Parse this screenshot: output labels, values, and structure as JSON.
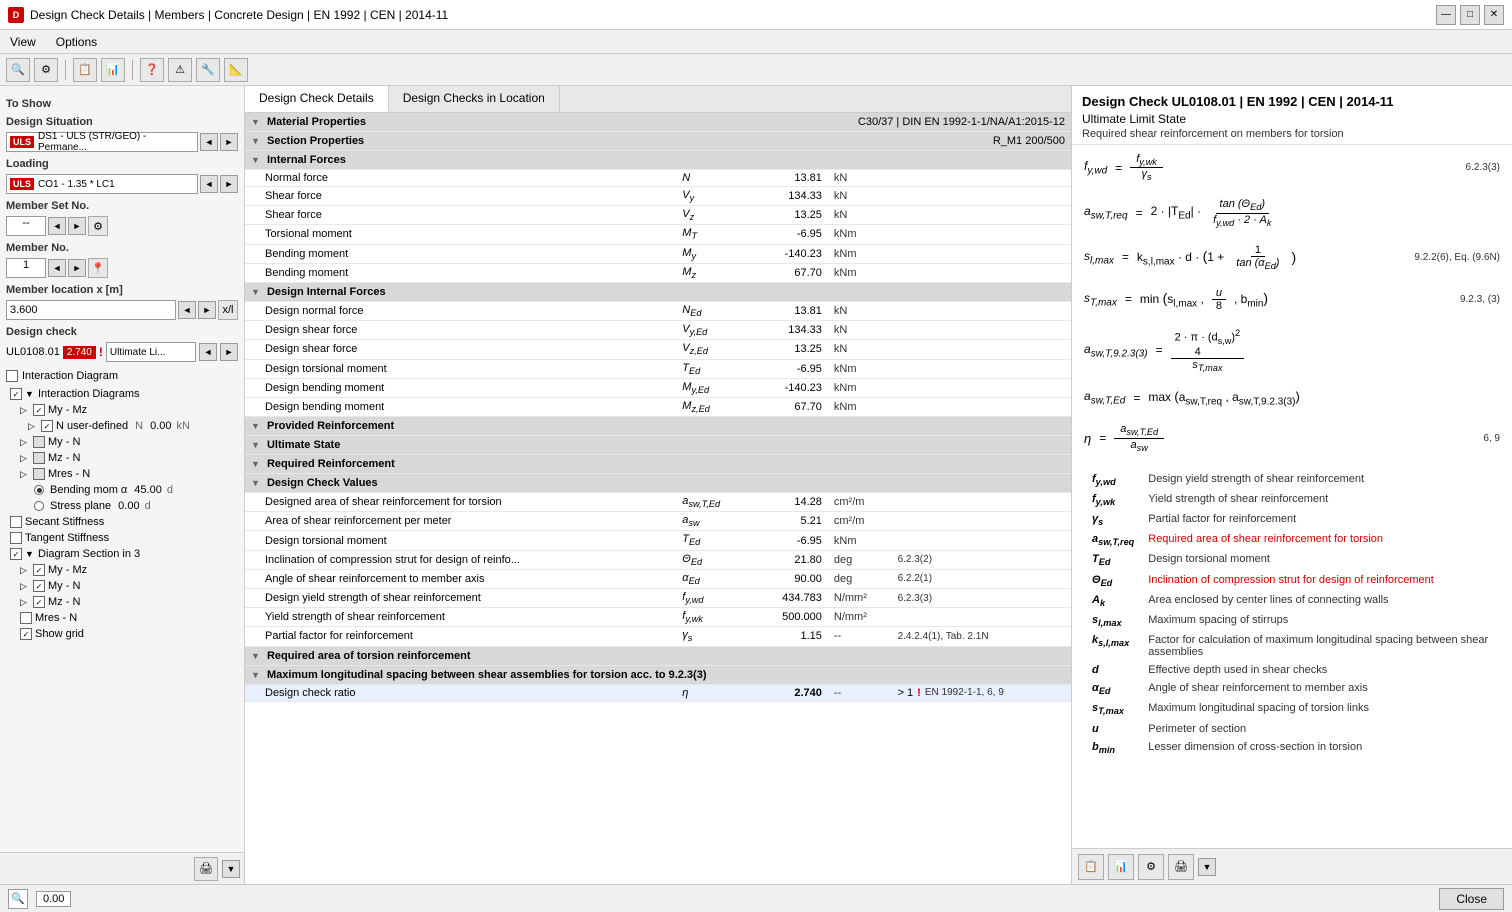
{
  "titleBar": {
    "title": "Design Check Details | Members | Concrete Design | EN 1992 | CEN | 2014-11",
    "minLabel": "—",
    "maxLabel": "□",
    "closeLabel": "✕"
  },
  "menuBar": {
    "items": [
      "View",
      "Options"
    ]
  },
  "leftPanel": {
    "toShow": "To Show",
    "designSituation": "Design Situation",
    "ds1Label": "DS1 - ULS (STR/GEO) - Permane...",
    "loading": "Loading",
    "co1Label": "CO1 - 1.35 * LC1",
    "memberSetNo": "Member Set No.",
    "memberSetVal": "--",
    "memberNo": "Member No.",
    "memberNoVal": "1",
    "memberLocation": "Member location x [m]",
    "memberLocationVal": "3.600",
    "designCheck": "Design check",
    "designCheckVal": "UL0108.01",
    "designCheckRatio": "2.740",
    "designCheckType": "Ultimate Li...",
    "interactionDiagram": "Interaction Diagram",
    "tree": {
      "interactionDiagrams": "Interaction Diagrams",
      "myMz": "My - Mz",
      "nUserDefined": "N user-defined",
      "nVal": "N",
      "nNum": "0.00",
      "myN": "My - N",
      "mzN": "Mz - N",
      "mresN": "Mres - N",
      "bendingMoment": "Bending mom α",
      "bendingVal": "45.00",
      "bendingUnit": "d",
      "secantStiffness": "Secant Stiffness",
      "tangentStiffness": "Tangent Stiffness",
      "diagramSection": "Diagram Section in 3",
      "myMz2": "My - Mz",
      "myN2": "My - N",
      "mzN2": "Mz - N",
      "mresN2": "Mres - N",
      "showGrid": "Show grid",
      "stressPlane": "Stress plane",
      "stressVal": "0.00",
      "stressUnit": "d"
    }
  },
  "tabs": {
    "tab1": "Design Check Details",
    "tab2": "Design Checks in Location"
  },
  "centerPanel": {
    "materialProps": "Material Properties",
    "materialVal": "C30/37 | DIN EN 1992-1-1/NA/A1:2015-12",
    "sectionProps": "Section Properties",
    "sectionVal": "R_M1 200/500",
    "internalForces": "Internal Forces",
    "forces": [
      {
        "name": "Normal force",
        "symbol": "N",
        "value": "13.81",
        "unit": "kN"
      },
      {
        "name": "Shear force",
        "symbol": "Vy",
        "value": "134.33",
        "unit": "kN"
      },
      {
        "name": "Shear force",
        "symbol": "Vz",
        "value": "13.25",
        "unit": "kN"
      },
      {
        "name": "Torsional moment",
        "symbol": "MT",
        "value": "-6.95",
        "unit": "kNm"
      },
      {
        "name": "Bending moment",
        "symbol": "My",
        "value": "-140.23",
        "unit": "kNm"
      },
      {
        "name": "Bending moment",
        "symbol": "Mz",
        "value": "67.70",
        "unit": "kNm"
      }
    ],
    "designInternalForces": "Design Internal Forces",
    "designForces": [
      {
        "name": "Design normal force",
        "symbol": "NEd",
        "value": "13.81",
        "unit": "kN"
      },
      {
        "name": "Design shear force",
        "symbol": "Vy,Ed",
        "value": "134.33",
        "unit": "kN"
      },
      {
        "name": "Design shear force",
        "symbol": "Vz,Ed",
        "value": "13.25",
        "unit": "kN"
      },
      {
        "name": "Design torsional moment",
        "symbol": "TEd",
        "value": "-6.95",
        "unit": "kNm"
      },
      {
        "name": "Design bending moment",
        "symbol": "My,Ed",
        "value": "-140.23",
        "unit": "kNm"
      },
      {
        "name": "Design bending moment",
        "symbol": "Mz,Ed",
        "value": "67.70",
        "unit": "kNm"
      }
    ],
    "providedReinforcement": "Provided Reinforcement",
    "ultimateState": "Ultimate State",
    "requiredReinforcement": "Required Reinforcement",
    "designCheckValues": "Design Check Values",
    "checkValues": [
      {
        "name": "Designed area of shear reinforcement for torsion",
        "symbol": "asw,T,Ed",
        "value": "14.28",
        "unit": "cm²/m",
        "ref": ""
      },
      {
        "name": "Area of shear reinforcement per meter",
        "symbol": "asw",
        "value": "5.21",
        "unit": "cm²/m",
        "ref": ""
      },
      {
        "name": "Design torsional moment",
        "symbol": "TEd",
        "value": "-6.95",
        "unit": "kNm",
        "ref": ""
      },
      {
        "name": "Inclination of compression strut for design of reinfo...",
        "symbol": "ΘEd",
        "value": "21.80",
        "unit": "deg",
        "ref": "6.2.3(2)"
      },
      {
        "name": "Angle of shear reinforcement to member axis",
        "symbol": "αEd",
        "value": "90.00",
        "unit": "deg",
        "ref": "6.2.2(1)"
      },
      {
        "name": "Design yield strength of shear reinforcement",
        "symbol": "fy,wd",
        "value": "434.783",
        "unit": "N/mm²",
        "ref": "6.2.3(3)"
      },
      {
        "name": "Yield strength of shear reinforcement",
        "symbol": "fy,wk",
        "value": "500.000",
        "unit": "N/mm²",
        "ref": ""
      },
      {
        "name": "Partial factor for reinforcement",
        "symbol": "γs",
        "value": "1.15",
        "unit": "--",
        "ref": "2.4.2.4(1), Tab. 2.1N"
      }
    ],
    "requiredTorsion": "Required area of torsion reinforcement",
    "maxSpacing": "Maximum longitudinal spacing between shear assemblies for torsion acc. to 9.2.3(3)",
    "checkRatio": "Design check ratio",
    "checkRatioSymbol": "η",
    "checkRatioValue": "2.740",
    "checkRatioUnit": "--",
    "checkRatioLimit": "> 1",
    "checkRatioRef": "EN 1992-1-1, 6, 9",
    "checkRatioFlag": "!"
  },
  "rightPanel": {
    "title": "Design Check UL0108.01 | EN 1992 | CEN | 2014-11",
    "state": "Ultimate Limit State",
    "description": "Required shear reinforcement on members for torsion",
    "formulas": [
      {
        "lhs": "fy,wd",
        "eq": "=",
        "rhs": "fy,wk / γs",
        "ref": "6.2.3(3)"
      },
      {
        "lhs": "asw,T,req",
        "eq": "=",
        "rhs": "2 · |TEd| · tan(ΘEd) / (fy,wd · 2 · Ak)",
        "ref": ""
      },
      {
        "lhs": "sl,max",
        "eq": "=",
        "rhs": "ks,l,max · d · (1 + 1/tan(αEd))",
        "ref": "9.2.2(6), Eq. (9.6N)"
      },
      {
        "lhs": "sT,max",
        "eq": "=",
        "rhs": "min(sl,max, u/8, bmin)",
        "ref": "9.2.3, (3)"
      },
      {
        "lhs": "asw,T,9.2.3(3)",
        "eq": "=",
        "rhs": "2π(ds,w)²/4 / sT,max",
        "ref": ""
      },
      {
        "lhs": "asw,T,Ed",
        "eq": "=",
        "rhs": "max(asw,T,req, asw,T,9.2.3(3))",
        "ref": ""
      },
      {
        "lhs": "η",
        "eq": "=",
        "rhs": "asw,T,Ed / asw",
        "ref": "6, 9"
      }
    ],
    "definitions": [
      {
        "symbol": "fy,wd",
        "desc": "Design yield strength of shear reinforcement",
        "colored": false
      },
      {
        "symbol": "fy,wk",
        "desc": "Yield strength of shear reinforcement",
        "colored": false
      },
      {
        "symbol": "γs",
        "desc": "Partial factor for reinforcement",
        "colored": false
      },
      {
        "symbol": "asw,T,req",
        "desc": "Required area of shear reinforcement for torsion",
        "colored": true
      },
      {
        "symbol": "TEd",
        "desc": "Design torsional moment",
        "colored": false
      },
      {
        "symbol": "ΘEd",
        "desc": "Inclination of compression strut for design of reinforcement",
        "colored": true
      },
      {
        "symbol": "Ak",
        "desc": "Area enclosed by center lines of connecting walls",
        "colored": false
      },
      {
        "symbol": "sl,max",
        "desc": "Maximum spacing of stirrups",
        "colored": false
      },
      {
        "symbol": "ks,l,max",
        "desc": "Factor for calculation of maximum longitudinal spacing between shear assemblies",
        "colored": false
      },
      {
        "symbol": "d",
        "desc": "Effective depth used in shear checks",
        "colored": false
      },
      {
        "symbol": "αEd",
        "desc": "Angle of shear reinforcement to member axis",
        "colored": false
      },
      {
        "symbol": "sT,max",
        "desc": "Maximum longitudinal spacing of torsion links",
        "colored": false
      },
      {
        "symbol": "u",
        "desc": "Perimeter of section",
        "colored": false
      },
      {
        "symbol": "bmin",
        "desc": "Lesser dimension of cross-section in torsion",
        "colored": false
      }
    ]
  },
  "statusBar": {
    "coordLabel": "0.00",
    "closeBtn": "Close"
  }
}
